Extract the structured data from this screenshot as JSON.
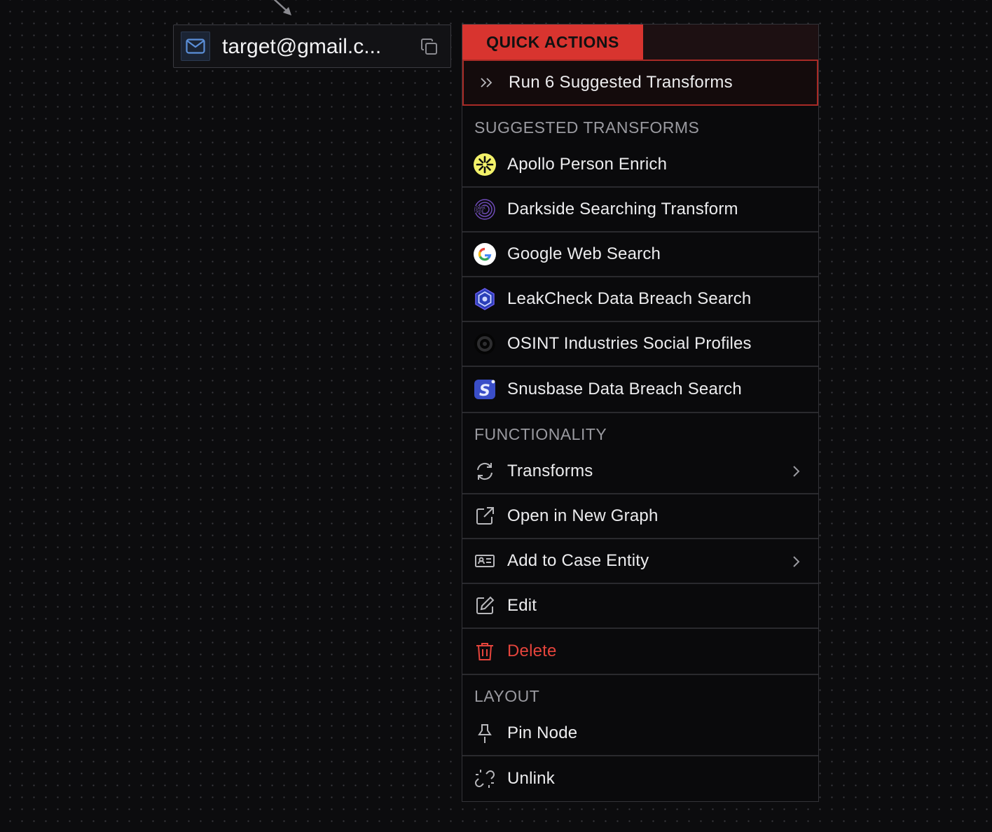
{
  "node": {
    "label": "target@gmail.c...",
    "icon": "mail-icon",
    "copy_icon": "copy-icon"
  },
  "menu": {
    "quick_actions_title": "QUICK ACTIONS",
    "run_label": "Run 6 Suggested Transforms",
    "suggested_title": "SUGGESTED TRANSFORMS",
    "suggested": [
      {
        "label": "Apollo Person Enrich",
        "icon": "apollo-icon"
      },
      {
        "label": "Darkside Searching Transform",
        "icon": "darkside-icon"
      },
      {
        "label": "Google Web Search",
        "icon": "google-icon"
      },
      {
        "label": "LeakCheck Data Breach Search",
        "icon": "leakcheck-icon"
      },
      {
        "label": "OSINT Industries Social Profiles",
        "icon": "osint-industries-icon"
      },
      {
        "label": "Snusbase Data Breach Search",
        "icon": "snusbase-icon"
      }
    ],
    "functionality_title": "FUNCTIONALITY",
    "functionality": [
      {
        "label": "Transforms",
        "icon": "refresh-icon",
        "submenu": true
      },
      {
        "label": "Open in New Graph",
        "icon": "external-link-icon",
        "submenu": false
      },
      {
        "label": "Add to Case Entity",
        "icon": "id-card-icon",
        "submenu": true
      },
      {
        "label": "Edit",
        "icon": "edit-icon",
        "submenu": false
      },
      {
        "label": "Delete",
        "icon": "trash-icon",
        "submenu": false
      }
    ],
    "layout_title": "LAYOUT",
    "layout": [
      {
        "label": "Pin Node",
        "icon": "pin-icon"
      },
      {
        "label": "Unlink",
        "icon": "unlink-icon"
      }
    ]
  },
  "colors": {
    "accent": "#d8342f",
    "danger": "#e5443c",
    "background": "#0c0c0e"
  }
}
